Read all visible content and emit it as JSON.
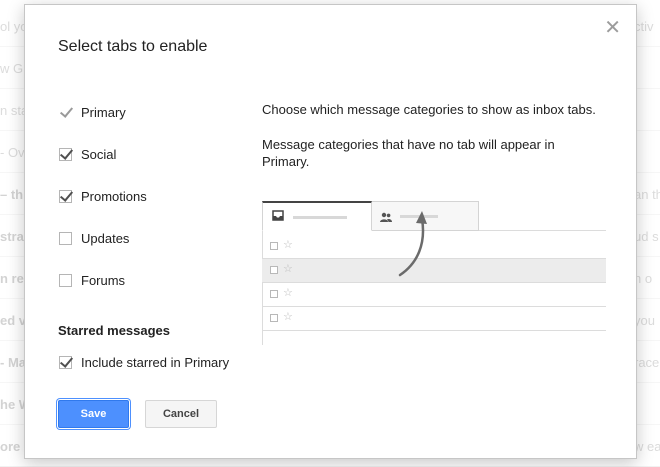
{
  "background_list": {
    "left_fragments": [
      {
        "text": "ol yo",
        "bold": false
      },
      {
        "text": "w G",
        "bold": false
      },
      {
        "text": "n sta",
        "bold": false
      },
      {
        "text": "- Ov",
        "bold": false
      },
      {
        "text": "– th",
        "bold": true
      },
      {
        "text": "stral",
        "bold": true
      },
      {
        "text": "n re",
        "bold": true
      },
      {
        "text": "ed v",
        "bold": true
      },
      {
        "text": "- Ma",
        "bold": true
      },
      {
        "text": "he W",
        "bold": true
      },
      {
        "text": "ore c",
        "bold": true
      }
    ],
    "right_fragments": [
      "ctiv",
      "",
      "",
      "",
      "an th",
      "ud s",
      "n o",
      "you",
      "race",
      "",
      "w ea"
    ]
  },
  "dialog": {
    "title": "Select tabs to enable",
    "close_glyph": "✕",
    "tabs": [
      {
        "label": "Primary",
        "checked": true,
        "disabled": true
      },
      {
        "label": "Social",
        "checked": true,
        "disabled": false
      },
      {
        "label": "Promotions",
        "checked": true,
        "disabled": false
      },
      {
        "label": "Updates",
        "checked": false,
        "disabled": false
      },
      {
        "label": "Forums",
        "checked": false,
        "disabled": false
      }
    ],
    "starred": {
      "heading": "Starred messages",
      "option_label": "Include starred in Primary",
      "checked": true
    },
    "description_1": "Choose which message categories to show as inbox tabs.",
    "description_2": "Message categories that have no tab will appear in Primary.",
    "illustration": {
      "tab_icons": [
        "inbox-icon",
        "people-icon"
      ],
      "row_count": 4,
      "shaded_row": 2
    },
    "buttons": {
      "save_label": "Save",
      "cancel_label": "Cancel"
    },
    "colors": {
      "primary_button": "#4d90fe",
      "primary_button_border": "#3079ed"
    }
  }
}
